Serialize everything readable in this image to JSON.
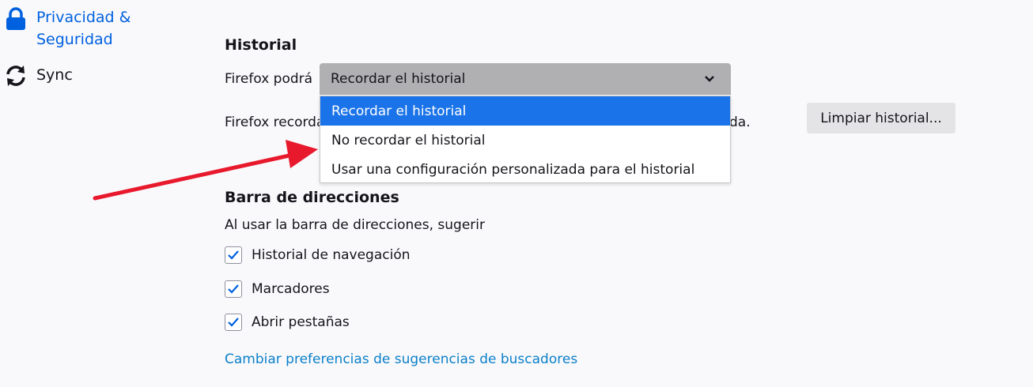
{
  "sidebar": {
    "items": [
      {
        "label": "Privacidad & Seguridad",
        "icon": "lock-icon",
        "active": true
      },
      {
        "label": "Sync",
        "icon": "sync-icon",
        "active": false
      }
    ]
  },
  "history": {
    "title": "Historial",
    "firefox_will_label": "Firefox podrá",
    "select_value": "Recordar el historial",
    "options": [
      "Recordar el historial",
      "No recordar el historial",
      "Usar una configuración personalizada para el historial"
    ],
    "description_start": "Firefox recorda",
    "description_end": "da.",
    "clear_button": "Limpiar historial..."
  },
  "address_bar": {
    "title": "Barra de direcciones",
    "subtitle": "Al usar la barra de direcciones, sugerir",
    "checkboxes": [
      {
        "label": "Historial de navegación",
        "checked": true
      },
      {
        "label": "Marcadores",
        "checked": true
      },
      {
        "label": "Abrir pestañas",
        "checked": true
      }
    ],
    "link": "Cambiar preferencias de sugerencias de buscadores"
  },
  "colors": {
    "accent": "#0061e0",
    "selected_option": "#1a73e8",
    "arrow": "#e8192c",
    "link": "#0b7fc9"
  }
}
